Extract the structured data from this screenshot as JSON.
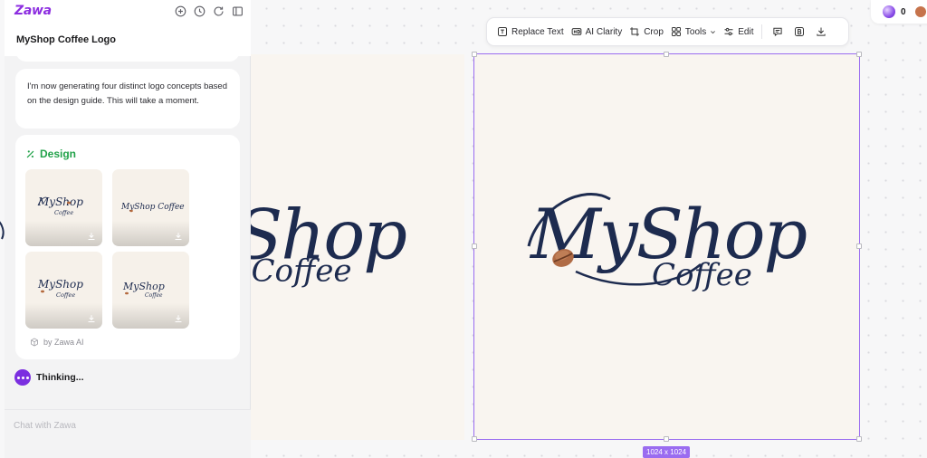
{
  "app": {
    "brand": "Zawa",
    "project_title": "MyShop Coffee Logo",
    "header_icons": [
      "plus-circle-icon",
      "clock-icon",
      "refresh-icon",
      "sidebar-toggle-icon"
    ]
  },
  "chat": {
    "assistant_message": "I'm now generating four distinct logo concepts based on the design guide. This will take a moment.",
    "design_card": {
      "heading": "Design",
      "heading_color": "#22a24a",
      "thumbnails": [
        {
          "primary": "MyShop",
          "secondary": "Coffee"
        },
        {
          "primary": "MyShop Coffee",
          "secondary": ""
        },
        {
          "primary": "MyShop",
          "secondary": "Coffee"
        },
        {
          "primary": "MyShop",
          "secondary": "Coffee"
        }
      ],
      "attribution": "by Zawa AI"
    },
    "status": "Thinking...",
    "input_placeholder": "Chat with Zawa",
    "input_value": ""
  },
  "canvas": {
    "logo_primary": "MyShop",
    "logo_secondary": "Coffee",
    "ink_color": "#1d2b4f",
    "frame_background": "#f9f5f0",
    "selection_color": "#9a6cf0",
    "size_label": "1024 x 1024"
  },
  "toolbar": {
    "replace_text": "Replace Text",
    "ai_clarity": "AI Clarity",
    "crop": "Crop",
    "tools": "Tools",
    "edit": "Edit"
  },
  "credits": {
    "count": "0"
  }
}
